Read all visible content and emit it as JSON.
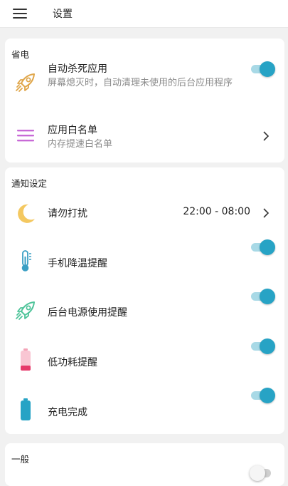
{
  "header": {
    "title": "设置"
  },
  "colors": {
    "accent": "#27a3c5",
    "toggle_track": "#a8d9e6"
  },
  "sections": {
    "power": {
      "title": "省电",
      "auto_kill": {
        "icon": "rocket-icon",
        "title": "自动杀死应用",
        "subtitle": "屏幕熄灭时，自动清理未使用的后台应用程序",
        "toggle": true
      },
      "whitelist": {
        "icon": "list-icon",
        "title": "应用白名单",
        "subtitle": "内存提速白名单"
      }
    },
    "notify": {
      "title": "通知设定",
      "dnd": {
        "icon": "moon-icon",
        "title": "请勿打扰",
        "value": "22:00 - 08:00"
      },
      "cooling": {
        "icon": "thermometer-icon",
        "title": "手机降温提醒",
        "toggle": true
      },
      "bg_power": {
        "icon": "rocket-icon",
        "title": "后台电源使用提醒",
        "toggle": true
      },
      "low_power": {
        "icon": "battery-low-icon",
        "title": "低功耗提醒",
        "toggle": true
      },
      "charge_done": {
        "icon": "battery-full-icon",
        "title": "充电完成",
        "toggle": true
      }
    },
    "general": {
      "title": "一般",
      "first": {
        "toggle": false
      }
    }
  }
}
